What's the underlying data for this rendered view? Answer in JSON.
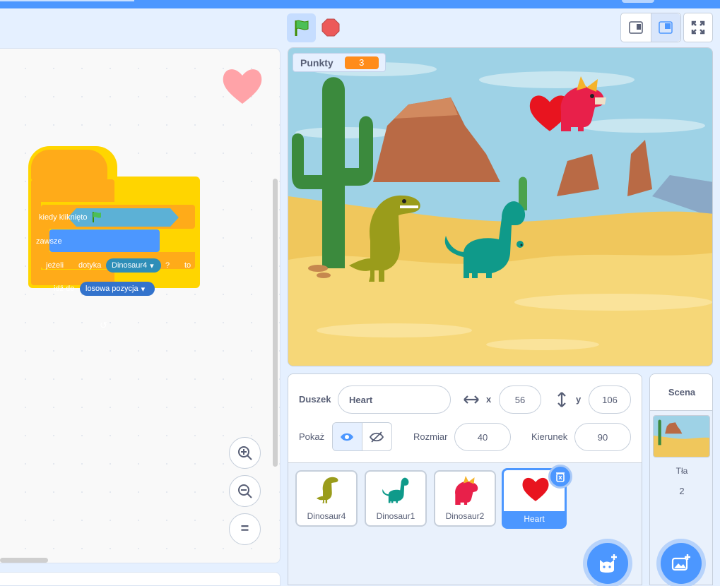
{
  "code": {
    "hat_label": "kiedy kliknięto",
    "forever_label": "zawsze",
    "if_label": "jeżeli",
    "then_label": "to",
    "touching_label": "dotyka",
    "touching_value": "Dinosaur4",
    "question_mark": "?",
    "goto_label": "idź do",
    "goto_value": "losowa pozycja",
    "zoom_reset_label": "="
  },
  "stage": {
    "monitor_label": "Punkty",
    "monitor_value": "3"
  },
  "sprite_info": {
    "sprite_label": "Duszek",
    "sprite_name": "Heart",
    "x_label": "x",
    "x_value": "56",
    "y_label": "y",
    "y_value": "106",
    "show_label": "Pokaż",
    "size_label": "Rozmiar",
    "size_value": "40",
    "direction_label": "Kierunek",
    "direction_value": "90"
  },
  "sprites": [
    {
      "name": "Dinosaur4",
      "selected": false
    },
    {
      "name": "Dinosaur1",
      "selected": false
    },
    {
      "name": "Dinosaur2",
      "selected": false
    },
    {
      "name": "Heart",
      "selected": true
    }
  ],
  "scene": {
    "title": "Scena",
    "backdrops_label": "Tła",
    "backdrops_count": "2"
  },
  "colors": {
    "accent": "#4c97ff",
    "events": "#ffab19",
    "sensing": "#5cb1d6",
    "motion": "#4c97ff",
    "highlight": "#ffd500",
    "monitor": "#ff8c1a"
  }
}
